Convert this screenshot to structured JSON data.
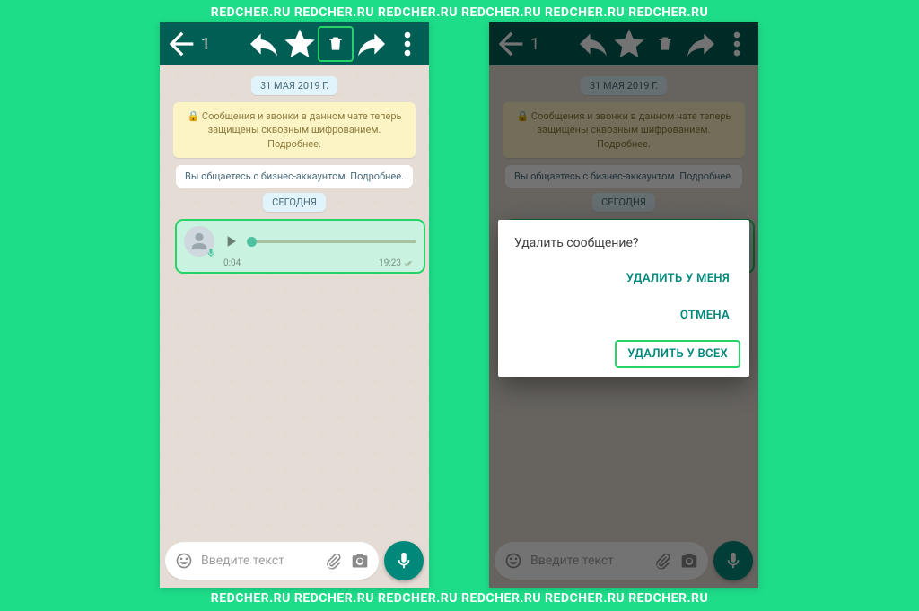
{
  "watermark": "REDCHER.RU  REDCHER.RU  REDCHER.RU  REDCHER.RU  REDCHER.RU  REDCHER.RU",
  "topbar": {
    "selected_count": "1"
  },
  "chat": {
    "date_label": "31 МАЯ 2019 Г.",
    "encryption_notice": "🔒 Сообщения и звонки в данном чате теперь защищены сквозным шифрованием. Подробнее.",
    "business_notice": "Вы общаетесь с бизнес-аккаунтом. Подробнее.",
    "today_label": "СЕГОДНЯ",
    "voice": {
      "duration": "0:04",
      "time": "19:23"
    }
  },
  "input": {
    "placeholder": "Введите текст"
  },
  "dialog": {
    "title": "Удалить сообщение?",
    "delete_for_me": "УДАЛИТЬ У МЕНЯ",
    "cancel": "ОТМЕНА",
    "delete_for_all": "УДАЛИТЬ У ВСЕХ"
  }
}
